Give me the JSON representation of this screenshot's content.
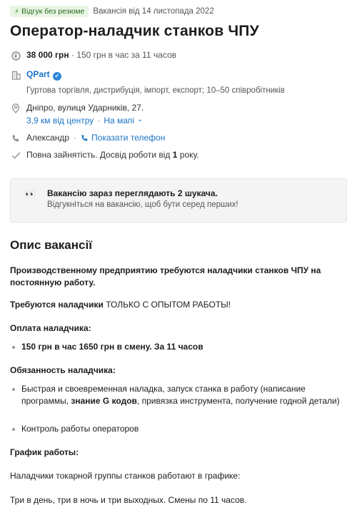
{
  "header": {
    "badge": "Відгук без резюме",
    "posted": "Вакансія від 14 листопада 2022",
    "title": "Оператор-наладчик станков ЧПУ"
  },
  "salary": {
    "amount": "38 000 грн",
    "details": " · 150 грн в час за 11 часов"
  },
  "company": {
    "name": "QPart",
    "description": "Гуртова торгівля, дистрибуція, імпорт, експорт; 10–50 співробітників"
  },
  "location": {
    "address": "Дніпро, вулиця Ударників, 27.",
    "distance": "3,9 км від центру",
    "map_link": "На мапі"
  },
  "contact": {
    "name": "Александр",
    "show_phone": "Показати телефон"
  },
  "conditions": {
    "text_a": "Повна зайнятість. Досвід роботи від ",
    "years": "1",
    "text_b": " року."
  },
  "notice": {
    "eyes": "👀",
    "title": "Вакансію зараз переглядають 2 шукача.",
    "subtitle": "Відгукніться на вакансію, щоб бути серед перших!"
  },
  "description": {
    "heading": "Опис вакансії",
    "intro": "Производственному предприятию требуются наладчики станков ЧПУ на постоянную работу.",
    "requirement_a": "Требуются наладчики ",
    "requirement_b": "ТОЛЬКО С ОПЫТОМ РАБОТЫ!",
    "pay_heading": "Оплата наладчика:",
    "pay_item": "150 грн в час 1650 грн в смену. За 11 часов",
    "duties_heading": "Обязанность наладчика:",
    "duty_1a": "Быстрая и своевременная наладка, запуск станка в работу (написание программы, ",
    "duty_1b": "знание G кодов",
    "duty_1c": ", привязка инструмента, получение годной детали)",
    "duty_2": "Контроль работы операторов",
    "schedule_heading": "График работы:",
    "schedule_1": "Наладчики токарной группы станков работают в графике:",
    "schedule_2": "Три в день, три в ночь и три выходных. Смены по 11 часов."
  }
}
